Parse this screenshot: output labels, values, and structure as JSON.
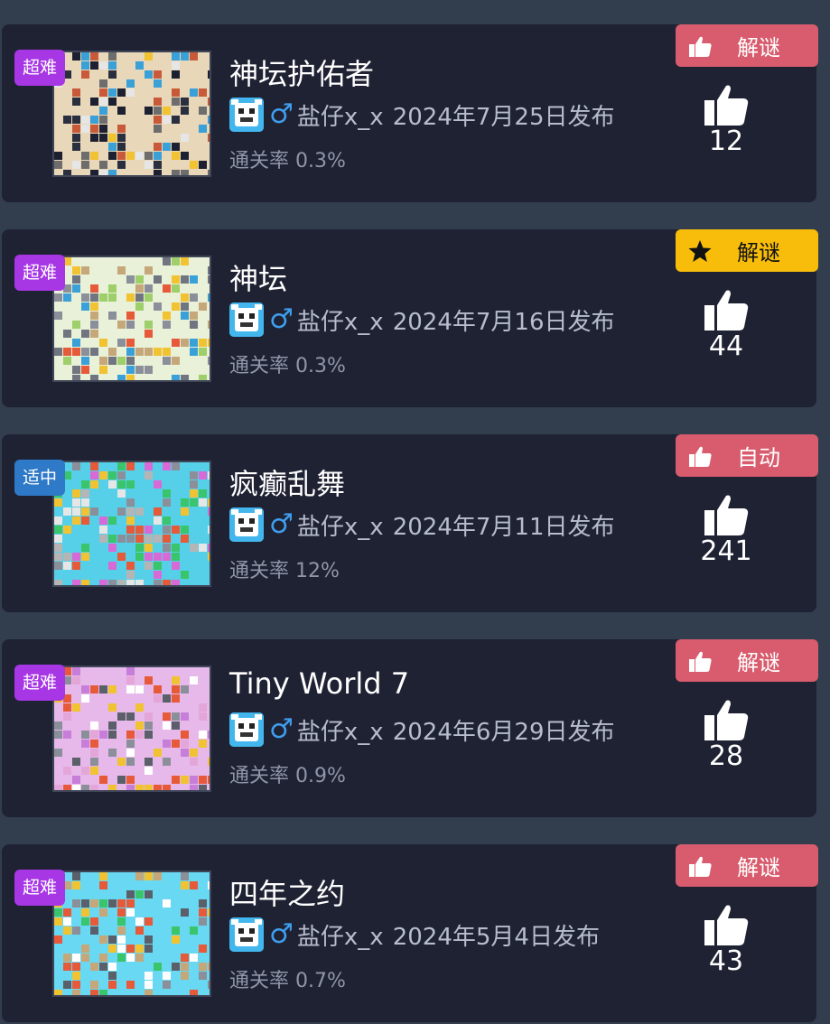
{
  "levels": [
    {
      "difficulty": "超难",
      "difficulty_color": "#a736e5",
      "title": "神坛护佑者",
      "author": "盐仔x_x",
      "gender": "♂",
      "date": "2024年7月25日发布",
      "clear_rate": "通关率 0.3%",
      "tag": "解谜",
      "tag_icon": "thumbs-up-icon",
      "tag_color": "#d85c6d",
      "likes": "12",
      "thumb_theme": "dark-tan"
    },
    {
      "difficulty": "超难",
      "difficulty_color": "#a736e5",
      "title": "神坛",
      "author": "盐仔x_x",
      "gender": "♂",
      "date": "2024年7月16日发布",
      "clear_rate": "通关率 0.3%",
      "tag": "解谜",
      "tag_icon": "star-icon",
      "tag_color": "#f7bd0a",
      "likes": "44",
      "thumb_theme": "light-green"
    },
    {
      "difficulty": "适中",
      "difficulty_color": "#2e79c8",
      "title": "疯癫乱舞",
      "author": "盐仔x_x",
      "gender": "♂",
      "date": "2024年7月11日发布",
      "clear_rate": "通关率 12%",
      "tag": "自动",
      "tag_icon": "thumbs-up-icon",
      "tag_color": "#d85c6d",
      "likes": "241",
      "thumb_theme": "cyan"
    },
    {
      "difficulty": "超难",
      "difficulty_color": "#a736e5",
      "title": "Tiny World 7",
      "author": "盐仔x_x",
      "gender": "♂",
      "date": "2024年6月29日发布",
      "clear_rate": "通关率 0.9%",
      "tag": "解谜",
      "tag_icon": "thumbs-up-icon",
      "tag_color": "#d85c6d",
      "likes": "28",
      "thumb_theme": "pink"
    },
    {
      "difficulty": "超难",
      "difficulty_color": "#a736e5",
      "title": "四年之约",
      "author": "盐仔x_x",
      "gender": "♂",
      "date": "2024年5月4日发布",
      "clear_rate": "通关率 0.7%",
      "tag": "解谜",
      "tag_icon": "thumbs-up-icon",
      "tag_color": "#d85c6d",
      "likes": "43",
      "thumb_theme": "sky"
    }
  ]
}
